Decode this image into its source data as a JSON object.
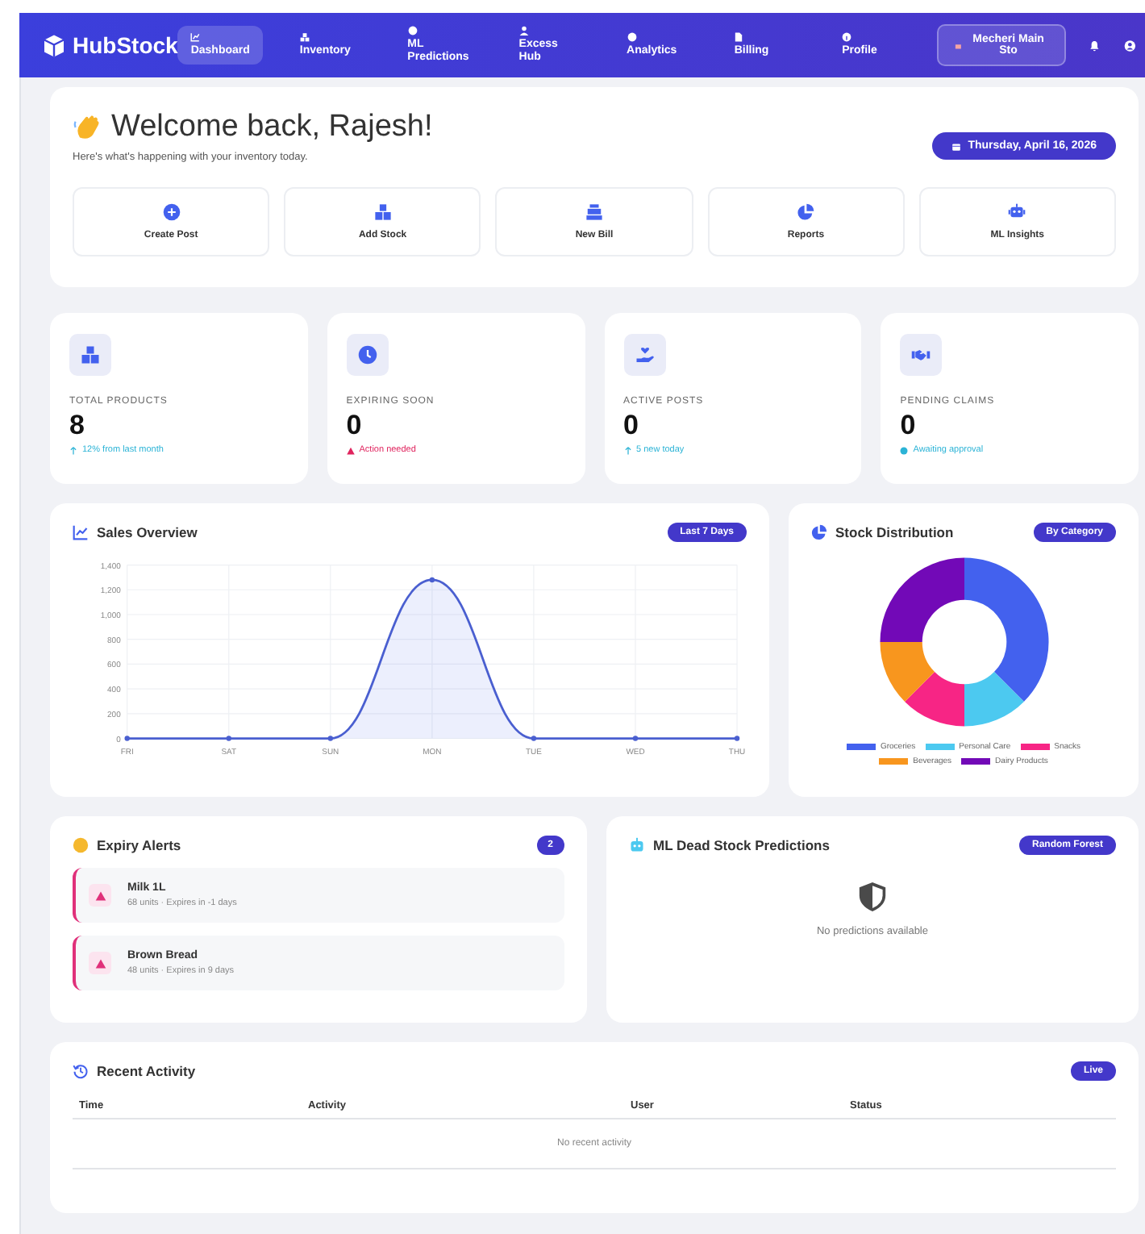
{
  "brand": "HubStock",
  "nav": [
    {
      "label": "Dashboard",
      "selected": true
    },
    {
      "label": "Inventory",
      "selected": false
    },
    {
      "label": "ML Predictions",
      "selected": false
    },
    {
      "label": "Excess Hub",
      "selected": false
    },
    {
      "label": "Analytics",
      "selected": false
    },
    {
      "label": "Billing",
      "selected": false
    },
    {
      "label": "Profile",
      "selected": false
    }
  ],
  "store": "Mecheri Main Sto",
  "welcome": {
    "title": "Welcome back, Rajesh!",
    "subtitle": "Here's what's happening with your inventory today.",
    "date": "Thursday, April 16, 2026"
  },
  "quick_actions": [
    {
      "label": "Create Post"
    },
    {
      "label": "Add Stock"
    },
    {
      "label": "New Bill"
    },
    {
      "label": "Reports"
    },
    {
      "label": "ML Insights"
    }
  ],
  "stats": [
    {
      "label": "TOTAL PRODUCTS",
      "value": "8",
      "note": "12% from last month",
      "kind": "up"
    },
    {
      "label": "EXPIRING SOON",
      "value": "0",
      "note": "Action needed",
      "kind": "warning"
    },
    {
      "label": "ACTIVE POSTS",
      "value": "0",
      "note": "5 new today",
      "kind": "up"
    },
    {
      "label": "PENDING CLAIMS",
      "value": "0",
      "note": "Awaiting approval",
      "kind": "pending"
    }
  ],
  "sales": {
    "title": "Sales Overview",
    "badge": "Last 7 Days",
    "chart_data": {
      "type": "area",
      "grid": true,
      "categories": [
        "FRI",
        "SAT",
        "SUN",
        "MON",
        "TUE",
        "WED",
        "THU"
      ],
      "values": [
        0,
        0,
        0,
        1280,
        0,
        0,
        0
      ],
      "ylim": [
        0,
        1400
      ],
      "yticks": [
        {
          "value": 0,
          "label": "0"
        },
        {
          "value": 200,
          "label": "200"
        },
        {
          "value": 400,
          "label": "400"
        },
        {
          "value": 600,
          "label": "600"
        },
        {
          "value": 800,
          "label": "800"
        },
        {
          "value": 1000,
          "label": "1,000"
        },
        {
          "value": 1200,
          "label": "1,200"
        },
        {
          "value": 1400,
          "label": "1,400"
        }
      ]
    }
  },
  "distribution": {
    "title": "Stock Distribution",
    "badge": "By Category",
    "chart_data": {
      "type": "donut",
      "legend": true,
      "categories": [
        "Groceries",
        "Personal Care",
        "Snacks",
        "Beverages",
        "Dairy Products"
      ],
      "values": [
        37.5,
        12.5,
        12.5,
        12.5,
        25
      ],
      "colors": [
        "#4361ee",
        "#4cc9f0",
        "#f72585",
        "#f8961e",
        "#7209b7"
      ]
    }
  },
  "expiry": {
    "title": "Expiry Alerts",
    "count": "2",
    "items": [
      {
        "name": "Milk 1L",
        "detail": "68 units · Expires in -1 days"
      },
      {
        "name": "Brown Bread",
        "detail": "48 units · Expires in 9 days"
      }
    ]
  },
  "predictions": {
    "title": "ML Dead Stock Predictions",
    "badge": "Random Forest",
    "empty": "No predictions available"
  },
  "activity": {
    "title": "Recent Activity",
    "badge": "Live",
    "columns": [
      "Time",
      "Activity",
      "User",
      "Status"
    ],
    "empty": "No recent activity"
  }
}
